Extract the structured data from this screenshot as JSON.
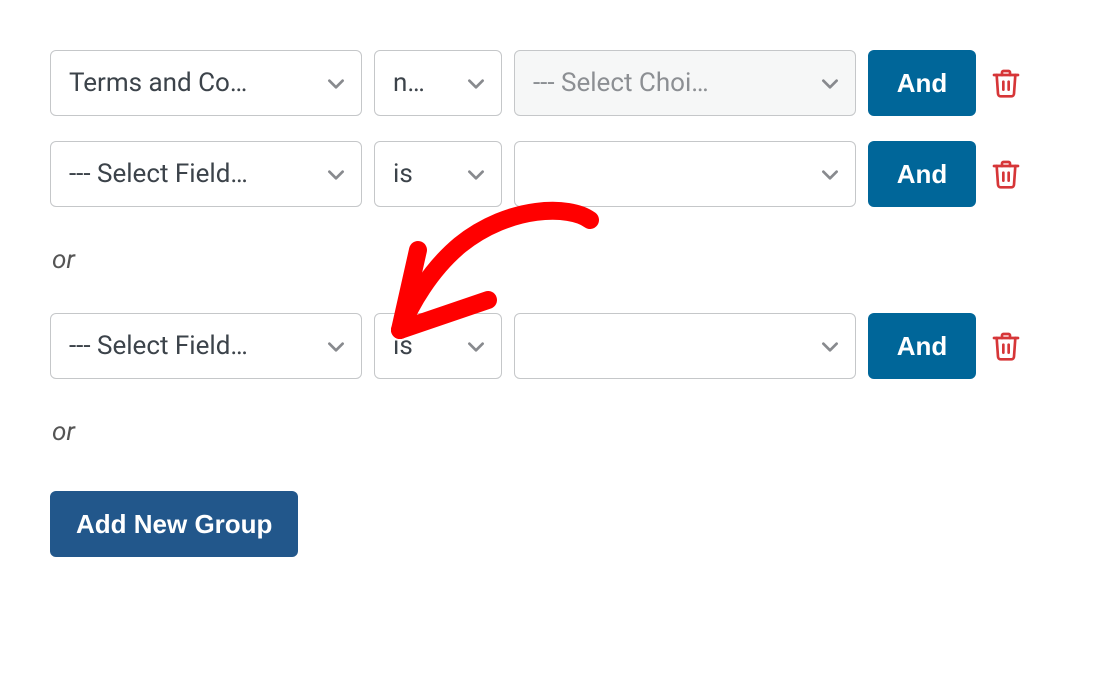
{
  "groups": [
    {
      "rules": [
        {
          "field": "Terms and Co…",
          "op": "n…",
          "value": "--- Select Choi…",
          "value_disabled": true,
          "conj": "And"
        },
        {
          "field": "--- Select Field…",
          "op": "is",
          "value": "",
          "value_disabled": false,
          "conj": "And"
        }
      ]
    },
    {
      "rules": [
        {
          "field": "--- Select Field…",
          "op": "is",
          "value": "",
          "value_disabled": false,
          "conj": "And"
        }
      ]
    }
  ],
  "separator_label": "or",
  "add_group_label": "Add New Group",
  "colors": {
    "primary": "#006699",
    "add_group": "#22578b",
    "danger": "#d63638"
  }
}
